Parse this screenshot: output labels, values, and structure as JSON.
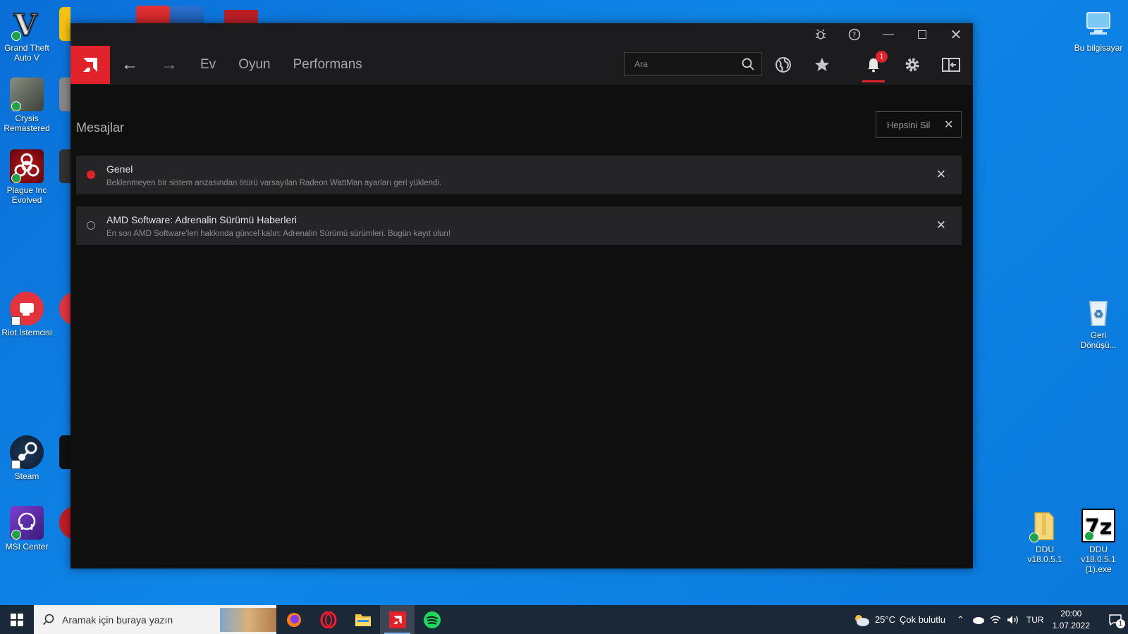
{
  "desktop": {
    "left_icons": [
      {
        "label": "Grand Theft Auto V"
      },
      {
        "label": "Crysis Remastered"
      },
      {
        "label": "Plague Inc Evolved"
      },
      {
        "label": "Riot İstemcisi"
      },
      {
        "label": "Steam"
      },
      {
        "label": "MSI Center"
      }
    ],
    "right_icons": [
      {
        "label": "Bu bilgisayar"
      },
      {
        "label": "Geri Dönüşü..."
      },
      {
        "label": "DDU v18.0.5.1"
      },
      {
        "label": "DDU v18.0.5.1 (1).exe"
      }
    ]
  },
  "app": {
    "nav": {
      "tabs": [
        "Ev",
        "Oyun",
        "Performans"
      ],
      "search_placeholder": "Ara",
      "notification_count": "1"
    },
    "messages": {
      "title": "Mesajlar",
      "delete_all": "Hepsini Sil",
      "items": [
        {
          "title": "Genel",
          "body": "Beklenmeyen bir sistem arızasından ötürü varsayılan Radeon WattMan ayarları geri yüklendi.",
          "unread": true
        },
        {
          "title": "AMD Software: Adrenalin Sürümü Haberleri",
          "body": "En son AMD Software'leri hakkında güncel kalın: Adrenalin Sürümü sürümleri. Bugün kayıt olun!",
          "unread": false
        }
      ]
    },
    "accent_color": "#e1222a"
  },
  "taskbar": {
    "search_placeholder": "Aramak için buraya yazın",
    "weather_temp": "25°C",
    "weather_text": "Çok bulutlu",
    "language": "TUR",
    "time": "20:00",
    "date": "1.07.2022",
    "notif_count": "1"
  }
}
